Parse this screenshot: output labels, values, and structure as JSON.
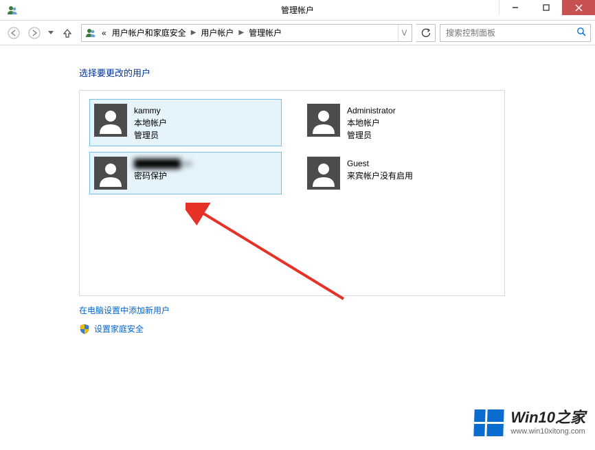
{
  "window": {
    "title": "管理帐户"
  },
  "nav": {
    "breadcrumb_prefix": "«",
    "crumbs": [
      "用户帐户和家庭安全",
      "用户帐户",
      "管理帐户"
    ],
    "search_placeholder": "搜索控制面板"
  },
  "page": {
    "heading": "选择要更改的用户",
    "accounts": [
      {
        "name": "kammy",
        "line2": "本地帐户",
        "line3": "管理员",
        "selected": true,
        "blurred": false
      },
      {
        "name": "Administrator",
        "line2": "本地帐户",
        "line3": "管理员",
        "selected": false,
        "blurred": false
      },
      {
        "name": "████████.cn",
        "line2": "密码保护",
        "line3": "",
        "selected": true,
        "blurred": true
      },
      {
        "name": "Guest",
        "line2": "来宾帐户没有启用",
        "line3": "",
        "selected": false,
        "blurred": false
      }
    ],
    "link_add_user": "在电脑设置中添加新用户",
    "link_family_safety": "设置家庭安全"
  },
  "watermark": {
    "main": "Win10之家",
    "sub": "www.win10xitong.com"
  }
}
